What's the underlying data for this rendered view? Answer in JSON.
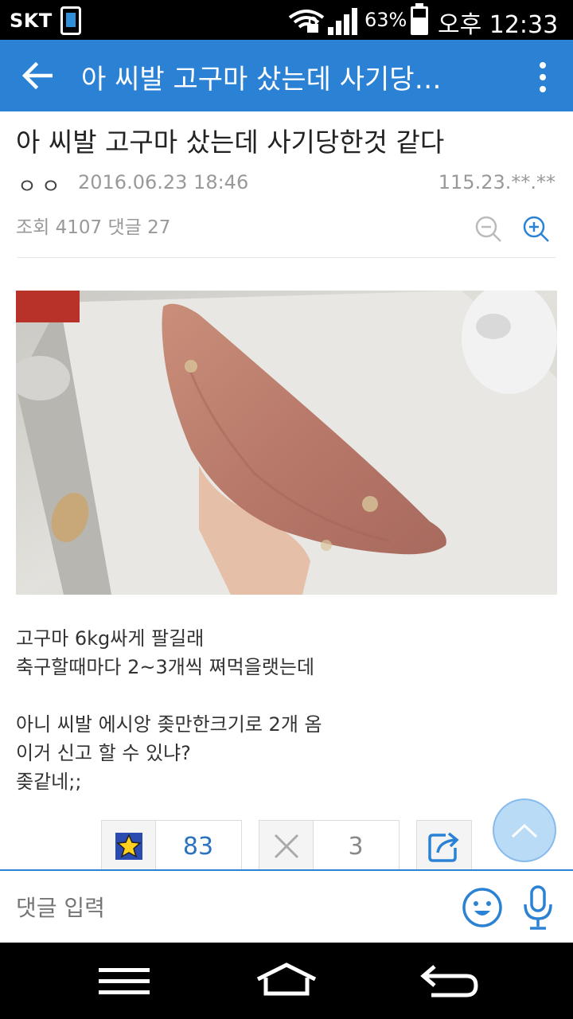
{
  "status_bar": {
    "carrier": "SKT",
    "battery_percent": "63%",
    "time": "오후 12:33",
    "icons": [
      "phone-icon",
      "wifi-lock-icon",
      "signal-icon",
      "battery-icon"
    ]
  },
  "app_bar": {
    "title": "아 씨발 고구마 샀는데 사기당…",
    "back_icon": "arrow-left-icon",
    "more_icon": "more-vertical-icon"
  },
  "post": {
    "title": "아 씨발 고구마 샀는데 사기당한것 같다",
    "author": "ㅇㅇ",
    "date": "2016.06.23 18:46",
    "ip": "115.23.**.**",
    "views": "조회 4107 댓글 27",
    "image_alt": "sweet-potato-photo",
    "body_lines": [
      "고구마 6kg싸게 팔길래",
      "축구할때마다 2~3개씩 쪄먹을랫는데",
      "",
      "아니 씨발 에시앙 좆만한크기로 2개 옴",
      "이거 신고 할 수 있냐?",
      "좆같네;;"
    ]
  },
  "actions": {
    "like_count": "83",
    "dislike_count": "3",
    "like_icon": "star-icon",
    "dislike_icon": "x-icon",
    "share_icon": "share-icon"
  },
  "comment": {
    "placeholder": "댓글 입력",
    "emoji_icon": "emoji-icon",
    "mic_icon": "mic-icon"
  },
  "nav_bar": {
    "icons": [
      "menu-icon",
      "home-icon",
      "back-icon"
    ]
  },
  "colors": {
    "app_bar": "#2b82d5",
    "like_count": "#2b72c0",
    "dislike_count": "#888888"
  }
}
